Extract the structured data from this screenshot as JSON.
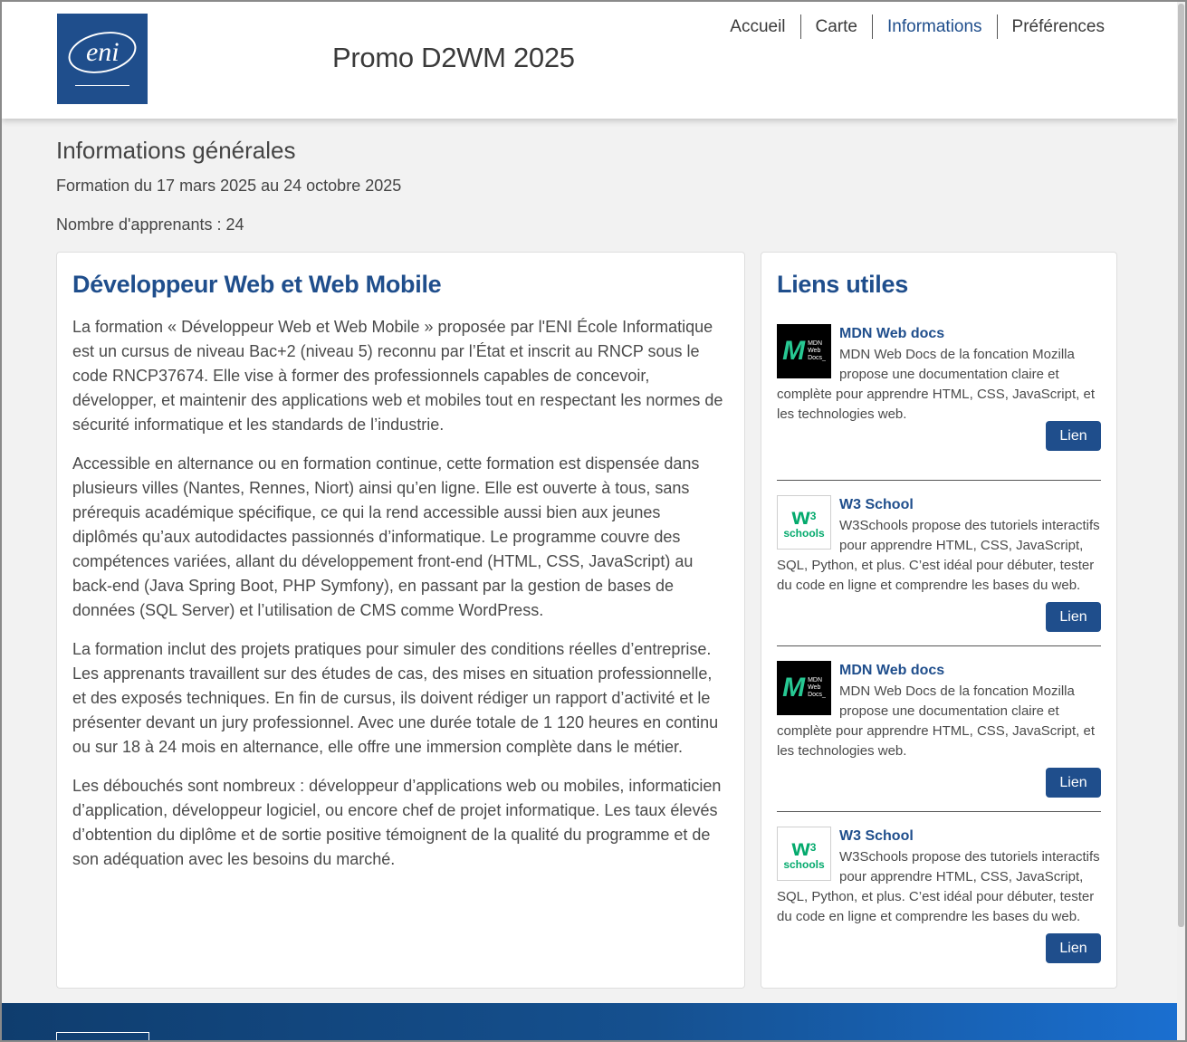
{
  "header": {
    "logo_text": "eni",
    "site_title": "Promo D2WM 2025",
    "nav": [
      {
        "label": "Accueil",
        "active": false
      },
      {
        "label": "Carte",
        "active": false
      },
      {
        "label": "Informations",
        "active": true
      },
      {
        "label": "Préférences",
        "active": false
      }
    ]
  },
  "intro": {
    "title": "Informations générales",
    "dates": "Formation du 17 mars 2025 au 24 octobre 2025",
    "learners": "Nombre d'apprenants : 24"
  },
  "main": {
    "title": "Développeur Web et Web Mobile",
    "paragraphs": [
      "La formation « Développeur Web et Web Mobile » proposée par l'ENI École Informatique est un cursus de niveau Bac+2 (niveau 5) reconnu par l’État et inscrit au RNCP sous le code RNCP37674. Elle vise à former des professionnels capables de concevoir, développer, et maintenir des applications web et mobiles tout en respectant les normes de sécurité informatique et les standards de l’industrie.",
      "Accessible en alternance ou en formation continue, cette formation est dispensée dans plusieurs villes (Nantes, Rennes, Niort) ainsi qu’en ligne. Elle est ouverte à tous, sans prérequis académique spécifique, ce qui la rend accessible aussi bien aux jeunes diplômés qu’aux autodidactes passionnés d’informatique. Le programme couvre des compétences variées, allant du développement front-end (HTML, CSS, JavaScript) au back-end (Java Spring Boot, PHP Symfony), en passant par la gestion de bases de données (SQL Server) et l’utilisation de CMS comme WordPress.",
      "La formation inclut des projets pratiques pour simuler des conditions réelles d’entreprise. Les apprenants travaillent sur des études de cas, des mises en situation professionnelle, et des exposés techniques. En fin de cursus, ils doivent rédiger un rapport d’activité et le présenter devant un jury professionnel. Avec une durée totale de 1 120 heures en continu ou sur 18 à 24 mois en alternance, elle offre une immersion complète dans le métier.",
      "Les débouchés sont nombreux : développeur d’applications web ou mobiles, informaticien d’application, développeur logiciel, ou encore chef de projet informatique. Les taux élevés d’obtention du diplôme et de sortie positive témoignent de la qualité du programme et de son adéquation avec les besoins du marché."
    ]
  },
  "side": {
    "title": "Liens utiles",
    "links": [
      {
        "title": "MDN Web docs",
        "desc": "MDN Web Docs de la foncation Mozilla propose une documentation claire et complète pour apprendre HTML, CSS, JavaScript, et les technologies web.",
        "button": "Lien",
        "logo_icon": "mdn-logo-icon",
        "logo_mark": "M",
        "logo_words": [
          "MDN",
          "Web",
          "Docs_"
        ]
      },
      {
        "title": "W3 School",
        "desc": "W3Schools propose des tutoriels interactifs pour apprendre HTML, CSS, JavaScript, SQL, Python, et plus. C’est idéal pour débuter, tester du code en ligne et comprendre les bases du web.",
        "button": "Lien",
        "logo_icon": "w3schools-logo-icon",
        "logo_mark": "w",
        "logo_sup": "3",
        "logo_words": [
          "schools"
        ]
      },
      {
        "title": "MDN Web docs",
        "desc": "MDN Web Docs de la foncation Mozilla propose une documentation claire et complète pour apprendre HTML, CSS, JavaScript, et les technologies web.",
        "button": "Lien",
        "logo_icon": "mdn-logo-icon",
        "logo_mark": "M",
        "logo_words": [
          "MDN",
          "Web",
          "Docs_"
        ]
      },
      {
        "title": "W3 School",
        "desc": "W3Schools propose des tutoriels interactifs pour apprendre HTML, CSS, JavaScript, SQL, Python, et plus. C’est idéal pour débuter, tester du code en ligne et comprendre les bases du web.",
        "button": "Lien",
        "logo_icon": "w3schools-logo-icon",
        "logo_mark": "w",
        "logo_sup": "3",
        "logo_words": [
          "schools"
        ]
      }
    ]
  },
  "colors": {
    "brand": "#1f4e8c",
    "footer_gradient_start": "#0f3d6e",
    "footer_gradient_end": "#1a6fd0"
  }
}
